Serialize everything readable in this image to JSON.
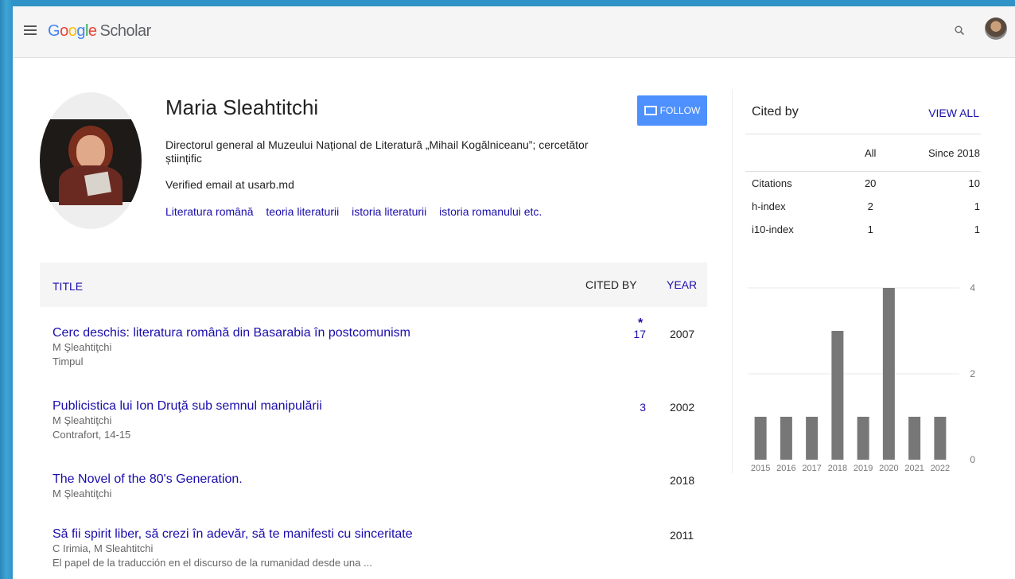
{
  "header": {
    "logo_google": "Google",
    "logo_scholar": "Scholar",
    "menu_icon": "hamburger-menu-icon",
    "search_icon": "search-icon"
  },
  "profile": {
    "name": "Maria Sleahtitchi",
    "affiliation": "Directorul general al Muzeului Național de Literatură „Mihail Kogălniceanu”; cercetător științific",
    "email": "Verified email at usarb.md",
    "interests": [
      "Literatura română",
      "teoria literaturii",
      "istoria literaturii",
      "istoria romanului etc."
    ],
    "follow_label": "FOLLOW"
  },
  "table": {
    "col_title": "TITLE",
    "col_cited": "CITED BY",
    "col_year": "YEAR",
    "articles": [
      {
        "title": "Cerc deschis: literatura română din Basarabia în postcomunism",
        "authors": "M Şleahtiţchi",
        "venue": "Timpul",
        "cited": "17",
        "star": "*",
        "year": "2007"
      },
      {
        "title": "Publicistica lui Ion Druţă sub semnul manipulării",
        "authors": "M Şleahtiţchi",
        "venue": "Contrafort, 14-15",
        "cited": "3",
        "star": "",
        "year": "2002"
      },
      {
        "title": "The Novel of the 80's Generation.",
        "authors": "M Şleahtiţchi",
        "venue": "",
        "cited": "",
        "star": "",
        "year": "2018"
      },
      {
        "title": "Să fii spirit liber, să crezi în adevăr, să te manifesti cu sinceritate",
        "authors": "C Irimia, M Sleahtitchi",
        "venue": "El papel de la traducción en el discurso de la rumanidad desde una ...",
        "cited": "",
        "star": "",
        "year": "2011"
      }
    ]
  },
  "cited_by": {
    "title": "Cited by",
    "view_all": "VIEW ALL",
    "col_all": "All",
    "col_since": "Since 2018",
    "rows": [
      {
        "label": "Citations",
        "all": "20",
        "since": "10"
      },
      {
        "label": "h-index",
        "all": "2",
        "since": "1"
      },
      {
        "label": "i10-index",
        "all": "1",
        "since": "1"
      }
    ]
  },
  "chart_data": {
    "type": "bar",
    "categories": [
      "2015",
      "2016",
      "2017",
      "2018",
      "2019",
      "2020",
      "2021",
      "2022"
    ],
    "values": [
      1,
      1,
      1,
      3,
      1,
      4,
      1,
      1
    ],
    "yticks": [
      "0",
      "2",
      "4"
    ],
    "ylim": [
      0,
      4
    ],
    "bar_color": "#777777",
    "grid": true
  }
}
